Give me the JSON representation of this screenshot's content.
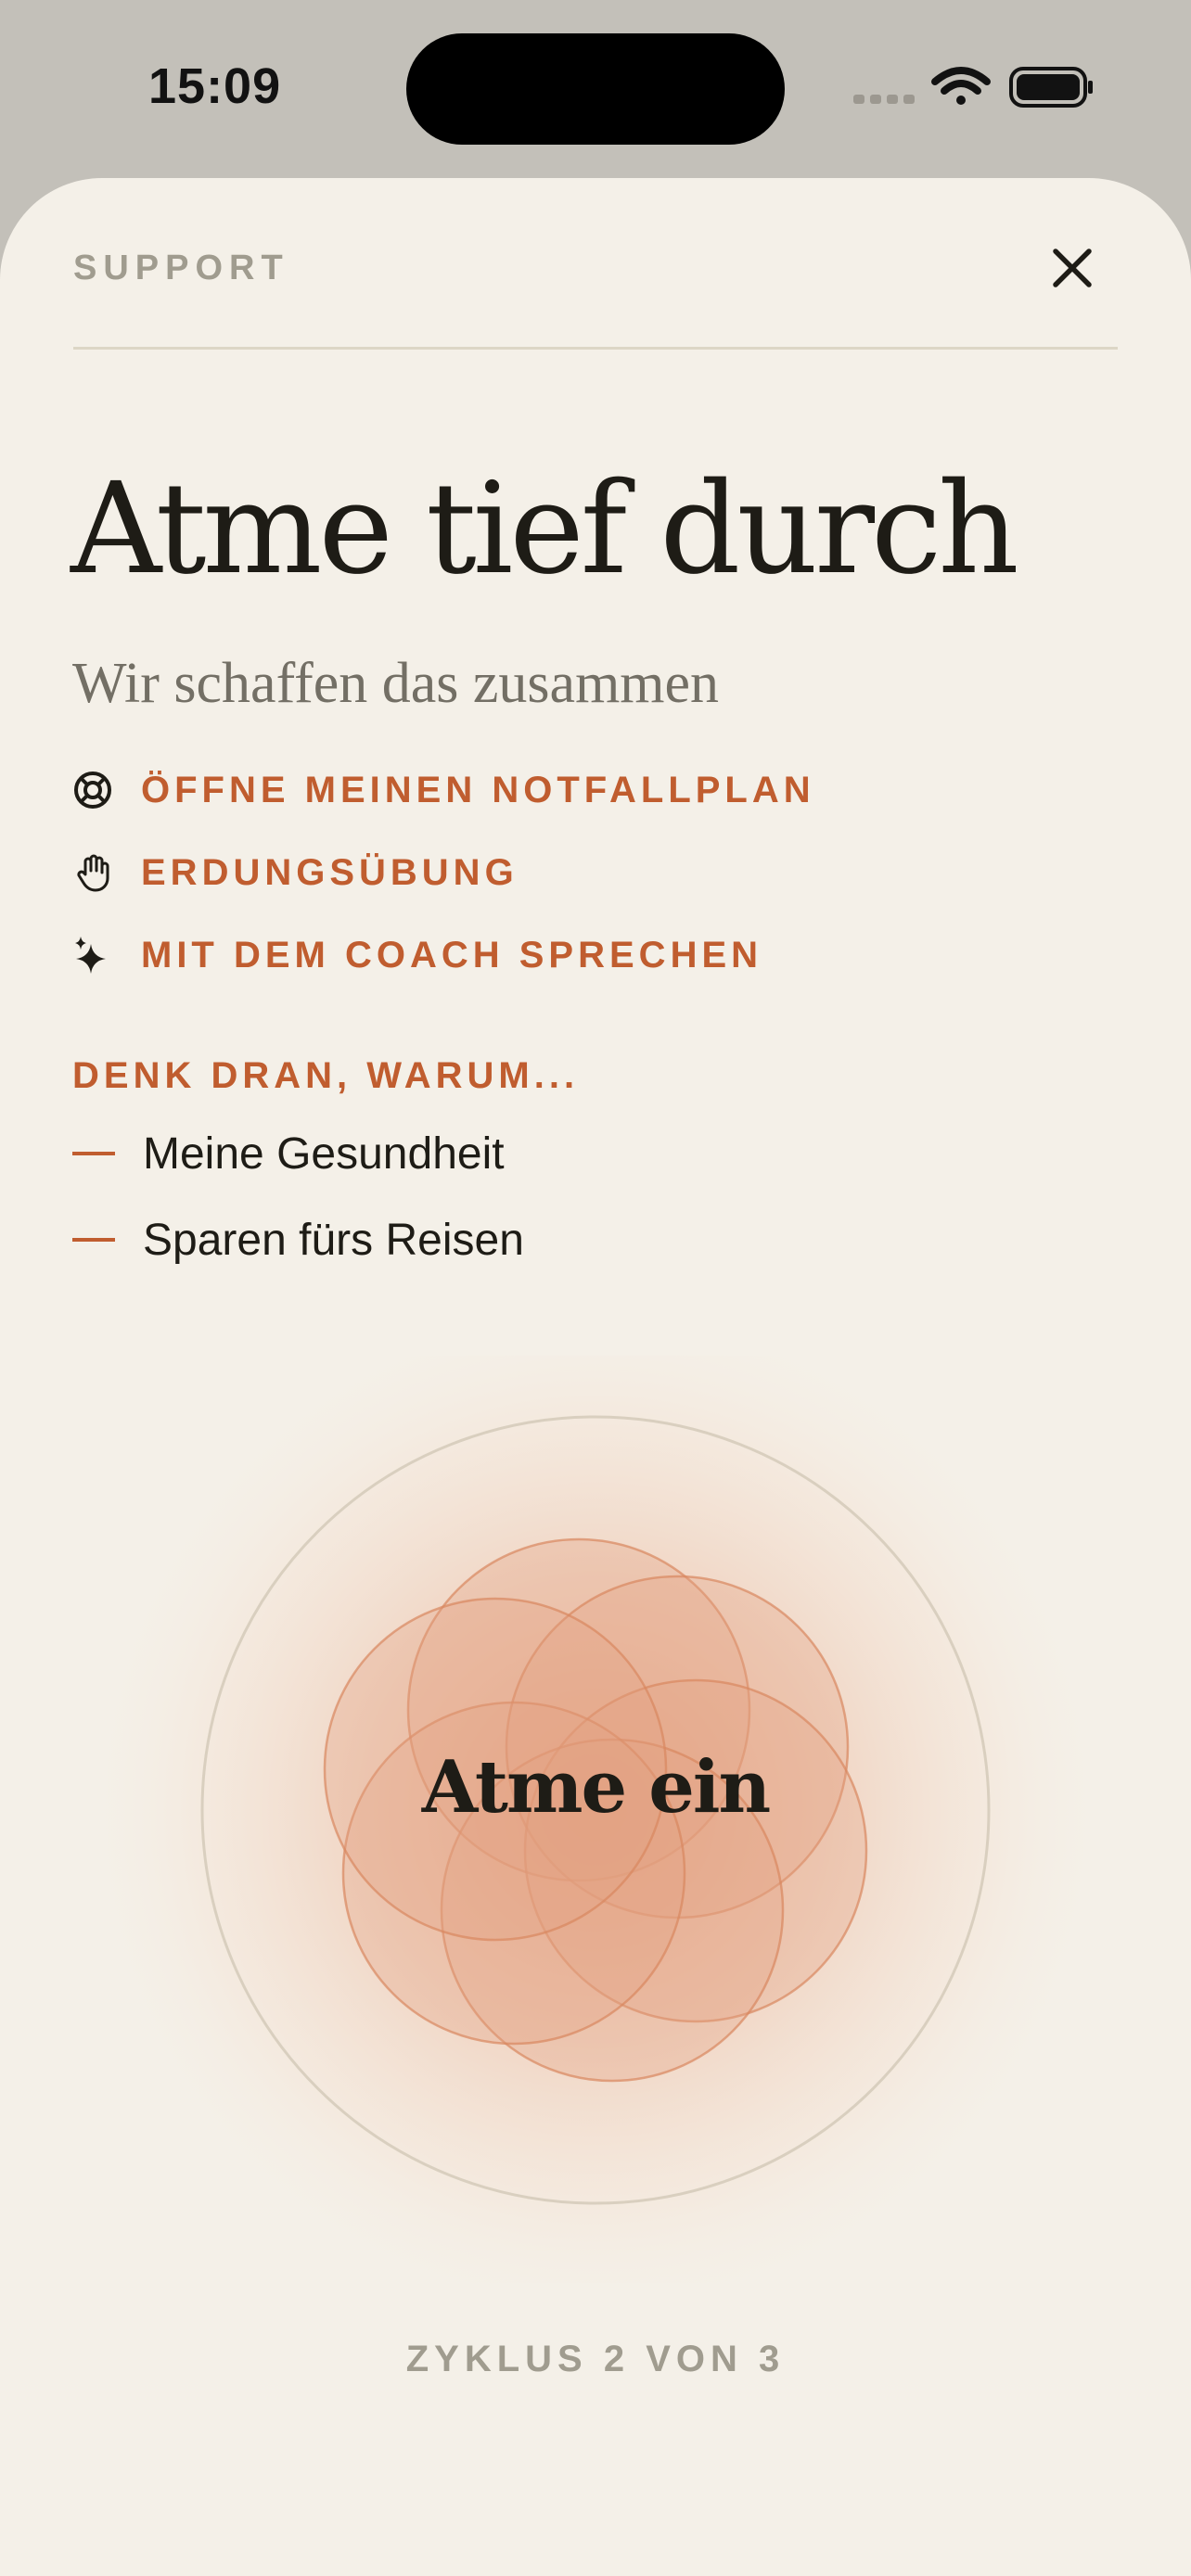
{
  "status_bar": {
    "time": "15:09"
  },
  "header": {
    "section_label": "SUPPORT",
    "close_icon": "close-icon"
  },
  "main": {
    "title": "Atme tief durch",
    "subtitle": "Wir schaffen das zusammen"
  },
  "actions": [
    {
      "label": "ÖFFNE MEINEN NOTFALLPLAN",
      "icon": "lifebuoy-icon"
    },
    {
      "label": "ERDUNGSÜBUNG",
      "icon": "hand-icon"
    },
    {
      "label": "MIT DEM COACH SPRECHEN",
      "icon": "sparkles-icon"
    }
  ],
  "reasons": {
    "heading": "DENK DRAN, WARUM...",
    "items": [
      "Meine Gesundheit",
      "Sparen fürs Reisen"
    ]
  },
  "breathing": {
    "instruction": "Atme ein",
    "cycle": "ZYKLUS 2 VON 3"
  },
  "colors": {
    "background": "#f4f0e8",
    "accent": "#c05d2f",
    "muted": "#a09c8f",
    "text": "#1e1c16",
    "petal": "#e3a384",
    "petal_stroke": "#d9875f"
  }
}
